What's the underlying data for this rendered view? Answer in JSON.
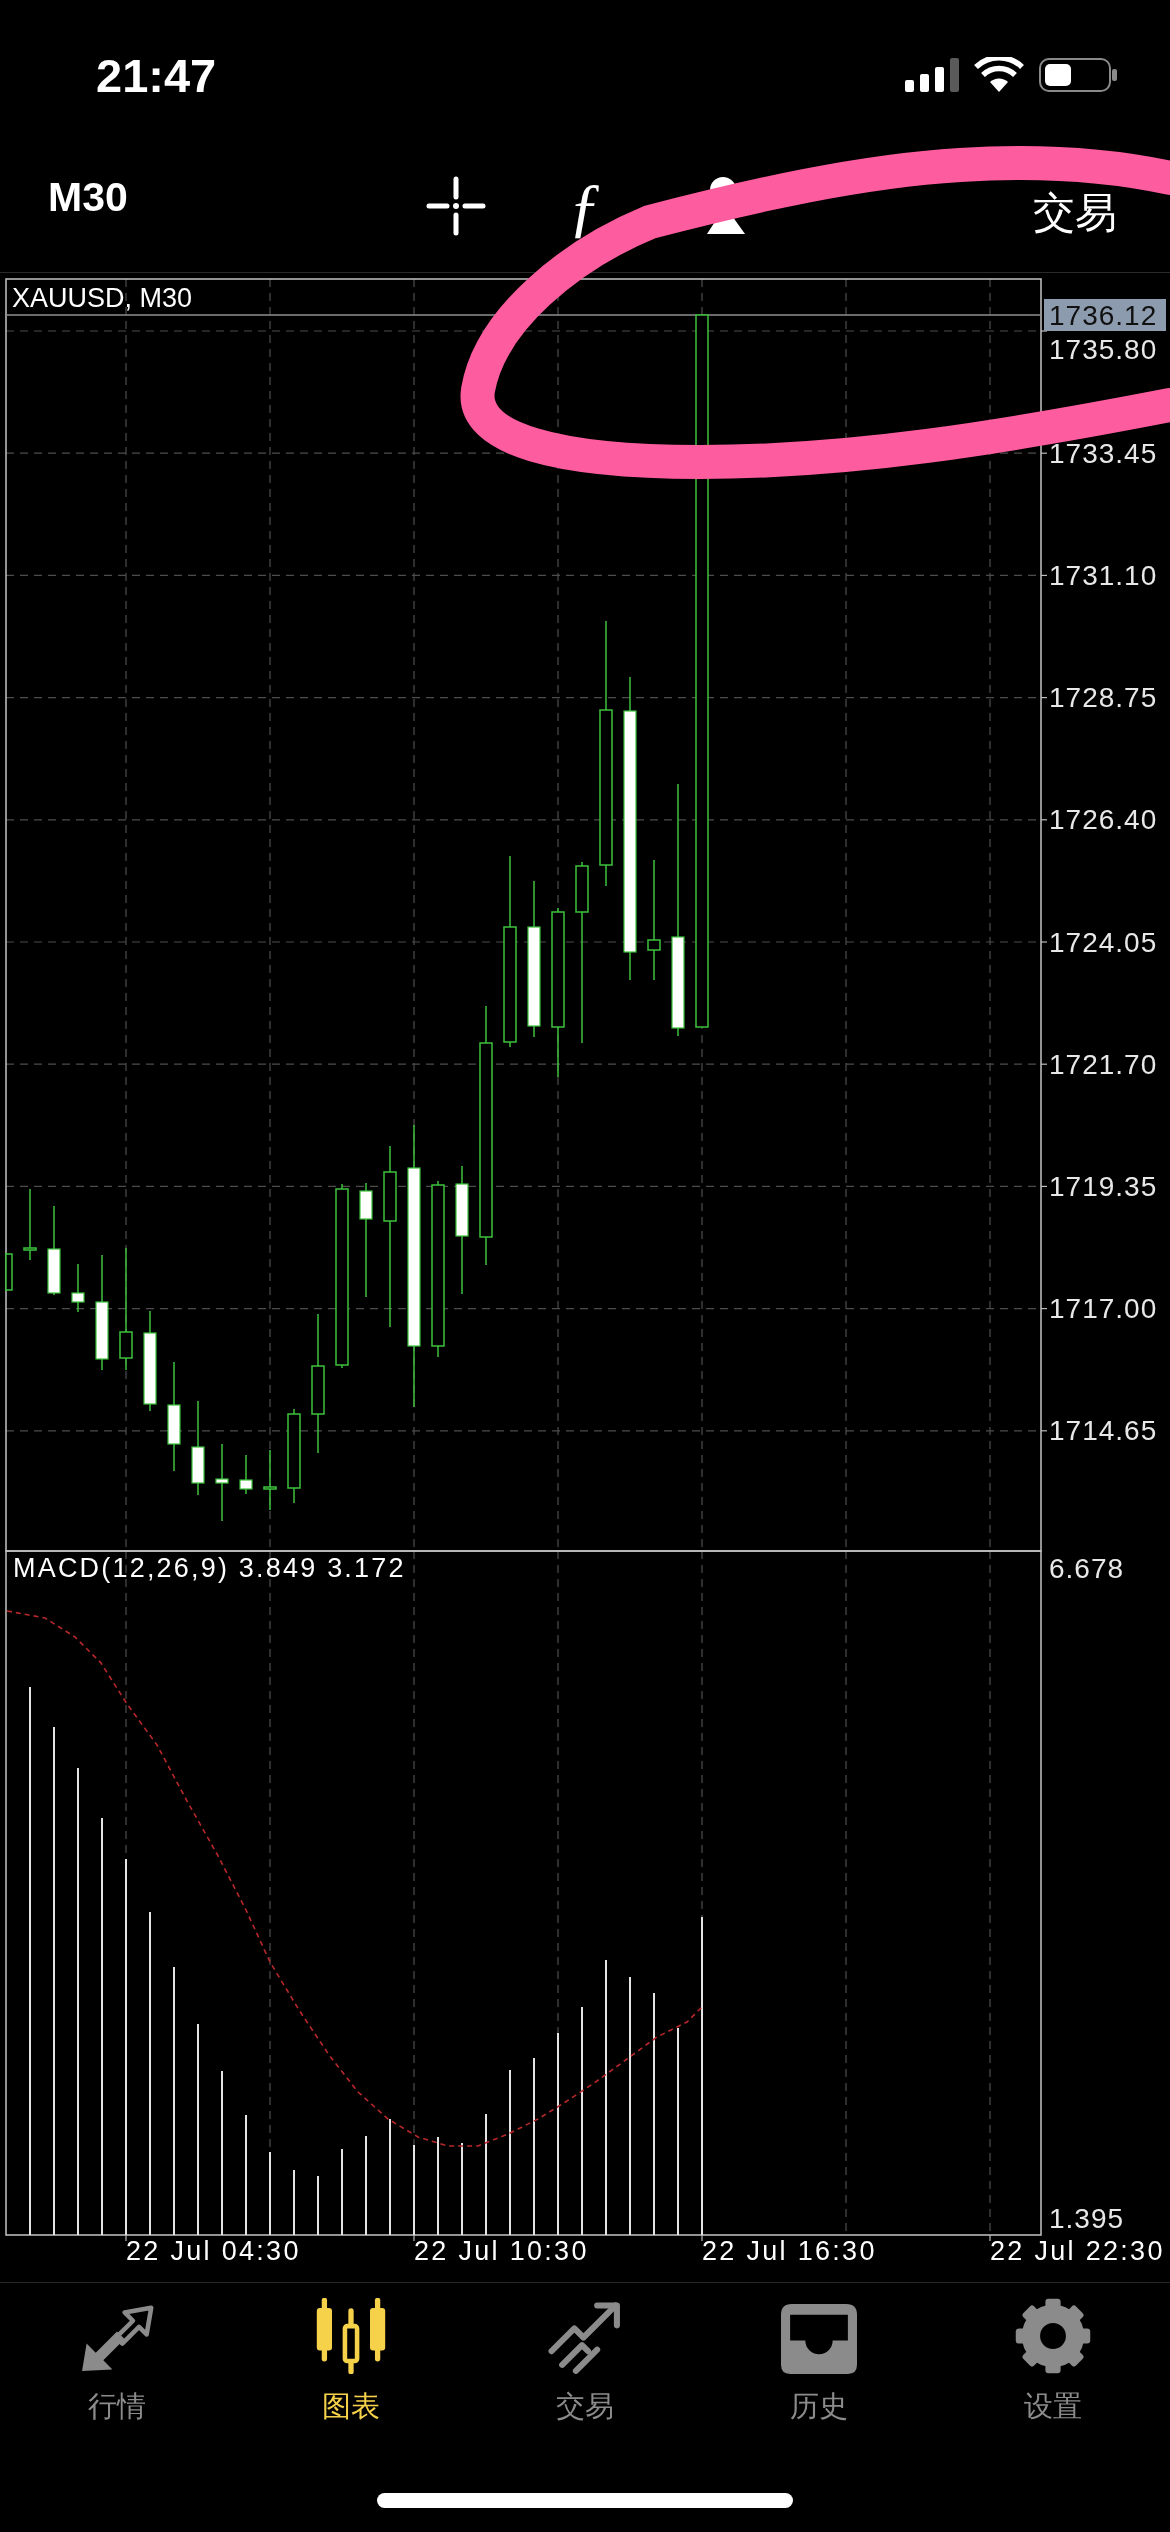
{
  "status_bar": {
    "time": "21:47"
  },
  "toolbar": {
    "timeframe": "M30",
    "function_button": "ƒ",
    "trade_button": "交易"
  },
  "chart": {
    "title": "XAUUSD, M30",
    "current_price": "1736.12",
    "price_axis": [
      "1735.80",
      "1733.45",
      "1731.10",
      "1728.75",
      "1726.40",
      "1724.05",
      "1721.70",
      "1719.35",
      "1717.00",
      "1714.65"
    ],
    "indicator": {
      "label": "MACD(12,26,9) 3.849 3.172",
      "axis": [
        "6.678",
        "1.395"
      ]
    },
    "time_axis": [
      "22 Jul 04:30",
      "22 Jul 10:30",
      "22 Jul 16:30",
      "22 Jul 22:30"
    ]
  },
  "tab_bar": [
    {
      "kind": "quotes",
      "label": "行情",
      "selected": false
    },
    {
      "kind": "chart",
      "label": "图表",
      "selected": true
    },
    {
      "kind": "trade",
      "label": "交易",
      "selected": false
    },
    {
      "kind": "history",
      "label": "历史",
      "selected": false
    },
    {
      "kind": "settings",
      "label": "设置",
      "selected": false
    }
  ]
}
